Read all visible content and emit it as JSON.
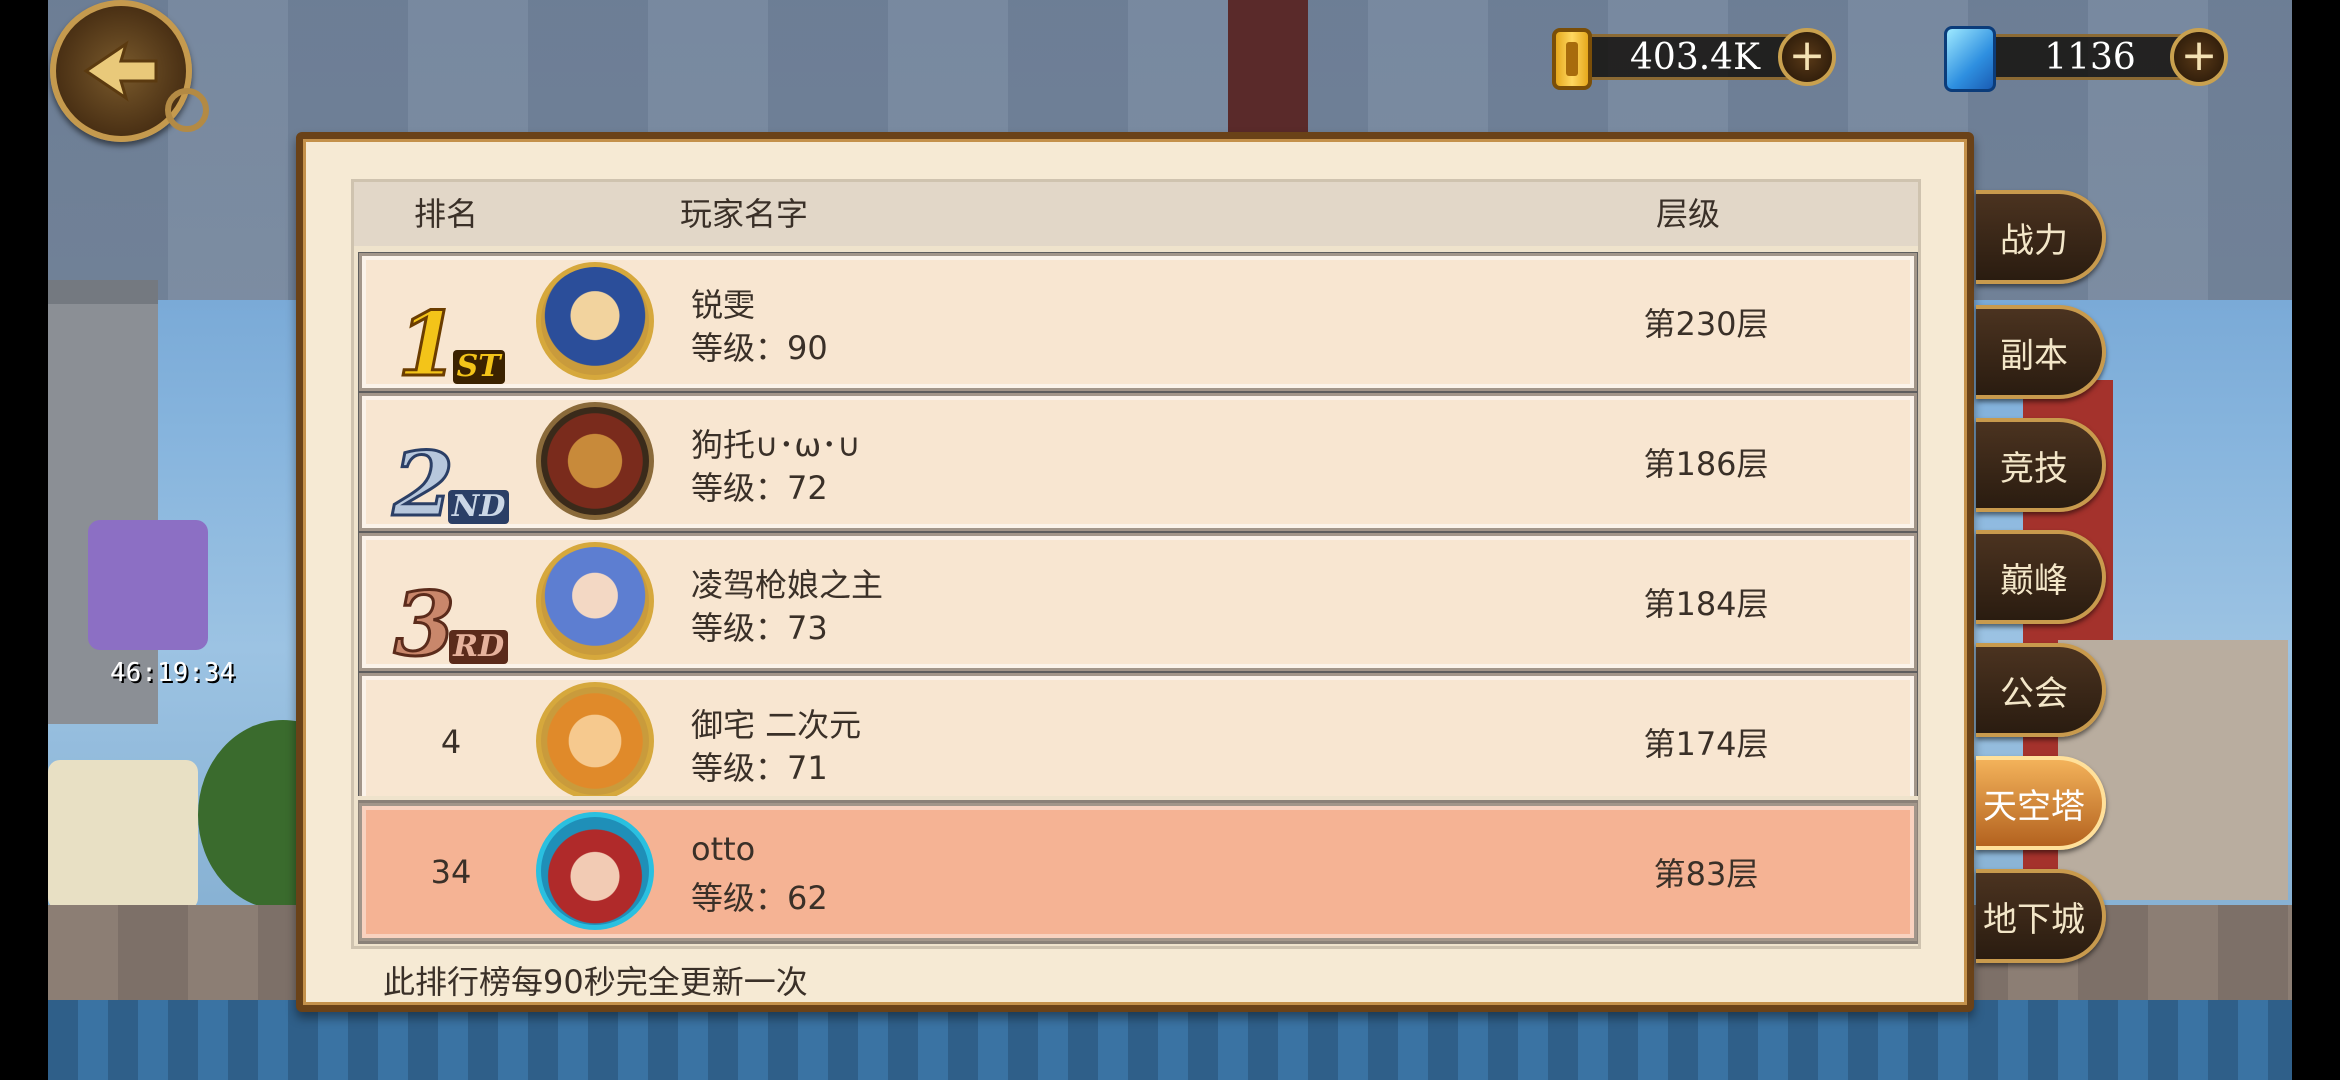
{
  "background": {
    "timer": "46:19:34"
  },
  "currency": {
    "gold": {
      "icon": "gold-bar-icon",
      "value": "403.4K",
      "add": "+"
    },
    "gems": {
      "icon": "blue-gem-icon",
      "value": "1136",
      "add": "+"
    }
  },
  "table": {
    "headers": {
      "rank": "排名",
      "player": "玩家名字",
      "floor": "层级"
    },
    "rows": [
      {
        "rank": "1",
        "medal_num": "1",
        "medal_suffix": "ST",
        "name": "锐雯",
        "level": "等级：90",
        "floor": "第230层"
      },
      {
        "rank": "2",
        "medal_num": "2",
        "medal_suffix": "ND",
        "name": "狗托∪･ω･∪",
        "level": "等级：72",
        "floor": "第186层"
      },
      {
        "rank": "3",
        "medal_num": "3",
        "medal_suffix": "RD",
        "name": "凌驾枪娘之主",
        "level": "等级：73",
        "floor": "第184层"
      },
      {
        "rank": "4",
        "name": "御宅 二次元",
        "level": "等级：71",
        "floor": "第174层"
      }
    ],
    "self": {
      "rank": "34",
      "name": "otto",
      "level": "等级：62",
      "floor": "第83层"
    }
  },
  "note": "此排行榜每90秒完全更新一次",
  "tabs": [
    {
      "label": "战力",
      "active": false
    },
    {
      "label": "副本",
      "active": false
    },
    {
      "label": "竞技",
      "active": false
    },
    {
      "label": "巅峰",
      "active": false
    },
    {
      "label": "公会",
      "active": false
    },
    {
      "label": "天空塔",
      "active": true
    },
    {
      "label": "地下城",
      "active": false
    }
  ],
  "colors": {
    "self_row": "#f5b394",
    "panel": "#f6ead4",
    "tab_active": "#f3b25a"
  }
}
